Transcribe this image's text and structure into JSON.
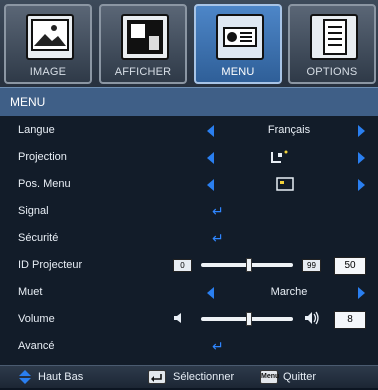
{
  "tabs": [
    {
      "label": "IMAGE",
      "icon": "image-icon"
    },
    {
      "label": "AFFICHER",
      "icon": "display-icon"
    },
    {
      "label": "MENU",
      "icon": "projector-menu-icon"
    },
    {
      "label": "OPTIONS",
      "icon": "options-icon"
    }
  ],
  "header": {
    "title": "MENU"
  },
  "rows": [
    {
      "label": "Langue",
      "value": "Français"
    },
    {
      "label": "Projection",
      "value_icon": "projection-mode-icon"
    },
    {
      "label": "Pos. Menu",
      "value_icon": "menu-position-icon"
    },
    {
      "label": "Signal",
      "value_icon": "enter-icon"
    },
    {
      "label": "Sécurité",
      "value_icon": "enter-icon"
    },
    {
      "label": "ID Projecteur",
      "min": "0",
      "max": "99",
      "value": "50",
      "level": 0.5
    },
    {
      "label": "Muet",
      "value": "Marche"
    },
    {
      "label": "Volume",
      "value": "8",
      "level": 0.5
    },
    {
      "label": "Avancé",
      "value_icon": "enter-icon"
    }
  ],
  "footer": {
    "nav_label": "Haut Bas",
    "select_label": "Sélectionner",
    "quit_label": "Quitter",
    "menu_key": "Menu"
  },
  "colors": {
    "accent": "#2a7ff0",
    "header": "#3f5f87",
    "active_tab": "#3f78bd"
  }
}
